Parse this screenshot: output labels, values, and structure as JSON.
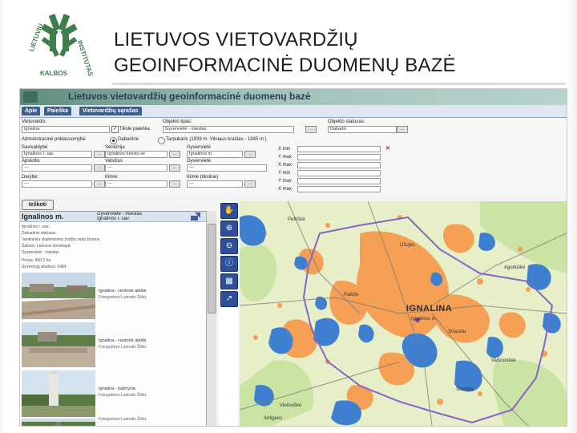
{
  "slide": {
    "title_line1": "LIETUVOS VIETOVARDŽIŲ",
    "title_line2": "GEOINFORMACINĖ DUOMENŲ BAZĖ"
  },
  "logo": {
    "text_left": "LIETUVIŲ",
    "text_bottom": "KALBOS",
    "text_right": "INSTITUTAS",
    "color": "#3f7e4e"
  },
  "app": {
    "banner_title": "Lietuvos vietovardžių geoinformacinė duomenų bazė",
    "tabs": [
      "Apie",
      "Paieška",
      "Vietovardžių sąrašas"
    ],
    "form": {
      "vietovardis_label": "Vietovardis:",
      "vietovardis_value": "Ignalina",
      "tiksle_label": "Tiksle paieška",
      "objekto_tipas_label": "Objekto tipas:",
      "objekto_tipas_value": "Gyvenvietė - miestas",
      "objekto_statusas_label": "Objekto statusas:",
      "objekto_statusas_value": "Dabartis",
      "admin_label": "Administracinė priklausomybė",
      "dabartine_label": "Dabartinė",
      "tarpukaris_label": "Tarpukaris (1939 m. Vilniaus kraštas - 1945 m.)",
      "savivaldybe_label": "Savivaldybė",
      "savivaldybe_value": "Ignalinos r. sav.",
      "seniunija_label": "Seniūnija",
      "seniunija_value": "Ignalinos miesto se",
      "gyvenviete_label": "Gyvenvietė",
      "gyvenviete_value": "Ignalinos m.",
      "apskritis_label": "Apskritis",
      "apskritis_value": "---",
      "valscius_label": "Valsčius",
      "valscius_value": "---",
      "gyvenviete2_label": "Gyvenvietė",
      "gyvenviete2_value": "---",
      "xmin_label": "X min",
      "ymax_label": "Y max",
      "xmax_label": "X max",
      "ymin_label": "Y min",
      "ymax2_label": "Y max",
      "xmax2_label": "X max",
      "darybe_label": "Darybė:",
      "darybe_value": "---",
      "kilme_label": "Kilmė:",
      "kilme_value": "---",
      "kilme_tikslinė_label": "Kilmė (tikslinė):",
      "kilme_tikslinė_value": "---",
      "ieskoti_label": "Ieškoti"
    },
    "info": {
      "place_title": "Ignalinos m.",
      "type_label": "Gyvenvietė - miestas",
      "muni_label": "Ignalinos r. sav.",
      "lines": [
        "Ignalinos r. sav.",
        "Dabartinis statusas",
        "Vardininko skaitmeninis žodžio vieta žinoma",
        "Šaltinis: Lietuvos žemėlapis",
        "Gyvenvietė - miestas",
        "Plotas: 800.2 ha",
        "Gyventojų skaičius: 6484"
      ],
      "photos": [
        {
          "caption": "Ignalina - centrinė aikštė",
          "credit": "Fotografavo Laimutis Šilkis"
        },
        {
          "caption": "Ignalina - centrinė aikštė",
          "credit": "Fotografavo Laimutis Šilkis"
        },
        {
          "caption": "Ignalina - bažnyčia",
          "credit": "Fotografavo Laimutis Šilkis"
        },
        {
          "caption": "",
          "credit": "Fotografavo Laimutis Šilkis"
        }
      ]
    },
    "tools": [
      "pan-hand-icon",
      "zoom-in-icon",
      "zoom-out-icon",
      "info-icon",
      "full-extent-icon",
      "measure-icon"
    ],
    "map": {
      "city_label": "IGNALINA",
      "city_sublabel": "Ignalinos m.",
      "labels": [
        "Petriškė",
        "Užupis",
        "Vaišnoriškė",
        "Palūšė",
        "Agurkiškė",
        "Šiliniškė",
        "Antiguos",
        "Vietoviškė",
        "Strazdai"
      ],
      "colors": {
        "urban": "#f5a055",
        "water": "#3f7fd0",
        "land": "#e7efc9",
        "forest": "#b5d88c",
        "boundary": "#8a63c6"
      }
    }
  }
}
